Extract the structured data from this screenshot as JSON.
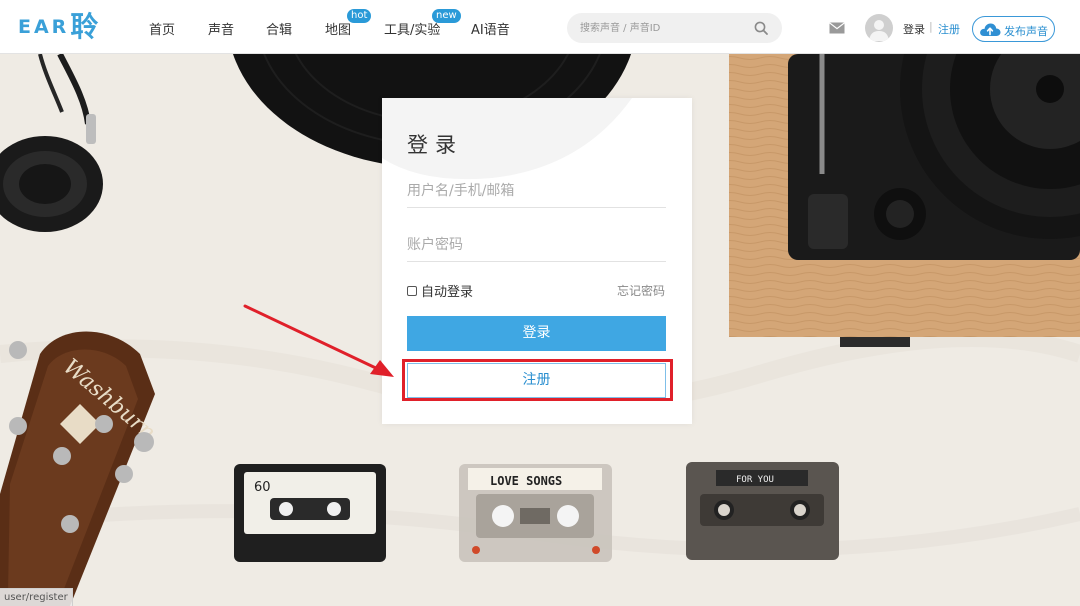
{
  "header": {
    "logo": {
      "latin": "EAR",
      "cjk": "聆"
    },
    "nav": [
      {
        "label": "首页",
        "badge": ""
      },
      {
        "label": "声音",
        "badge": ""
      },
      {
        "label": "合辑",
        "badge": ""
      },
      {
        "label": "地图",
        "badge": "hot"
      },
      {
        "label": "工具/实验",
        "badge": "new"
      },
      {
        "label": "AI语音",
        "badge": ""
      }
    ],
    "search": {
      "placeholder": "搜索声音 / 声音ID",
      "value": ""
    },
    "user_links": {
      "login": "登录",
      "separator": "|",
      "register": "注册"
    },
    "upload_button": "发布声音"
  },
  "login_form": {
    "title": "登录",
    "username_placeholder": "用户名/手机/邮箱",
    "password_placeholder": "账户密码",
    "remember_label": "自动登录",
    "remember_checked": false,
    "forgot_label": "忘记密码",
    "login_button": "登录",
    "register_button": "注册"
  },
  "background": {
    "guitar_brand": "Washburn",
    "cassettes": [
      {
        "label": "60"
      },
      {
        "label": "LOVE SONGS"
      },
      {
        "label": "FOR YOU"
      }
    ]
  },
  "status_bar": {
    "url": "user/register"
  },
  "colors": {
    "brand": "#3aa0d8",
    "primary_button": "#3fa7e3",
    "annotation": "#e0202a",
    "badge": "#2a9ad8"
  },
  "icons": {
    "search": "search-icon",
    "mail": "mail-icon",
    "avatar": "user-avatar-icon",
    "upload": "cloud-upload-icon"
  }
}
